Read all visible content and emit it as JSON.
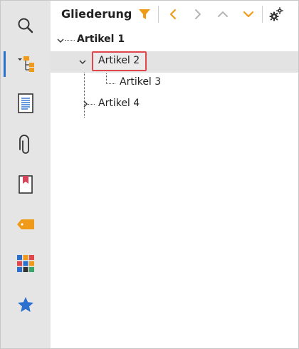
{
  "panel": {
    "title": "Gliederung"
  },
  "toolbar": {
    "filter_icon": "filter-icon",
    "prev_icon": "chevron-left-icon",
    "next_icon": "chevron-right-icon",
    "up_icon": "chevron-up-icon",
    "down_icon": "chevron-down-icon",
    "settings_icon": "gears-icon",
    "accent_color": "#f09a1a",
    "disabled_color": "#b5b5b5"
  },
  "sidebar": {
    "items": [
      {
        "icon": "search-icon"
      },
      {
        "icon": "outline-tree-icon",
        "active": true
      },
      {
        "icon": "page-icon"
      },
      {
        "icon": "paperclip-icon"
      },
      {
        "icon": "bookmark-icon"
      },
      {
        "icon": "tag-icon"
      },
      {
        "icon": "color-grid-icon"
      },
      {
        "icon": "star-icon"
      }
    ]
  },
  "tree": {
    "nodes": [
      {
        "label": "Artikel 1",
        "level": 0,
        "expanded": true,
        "bold": true
      },
      {
        "label": "Artikel 2",
        "level": 1,
        "expanded": true,
        "selected": true
      },
      {
        "label": "Artikel 3",
        "level": 2
      },
      {
        "label": "Artikel 4",
        "level": 1,
        "expanded": false
      }
    ]
  },
  "colors": {
    "selection_outline": "#e0474c",
    "active_indicator": "#2b6fcf"
  }
}
